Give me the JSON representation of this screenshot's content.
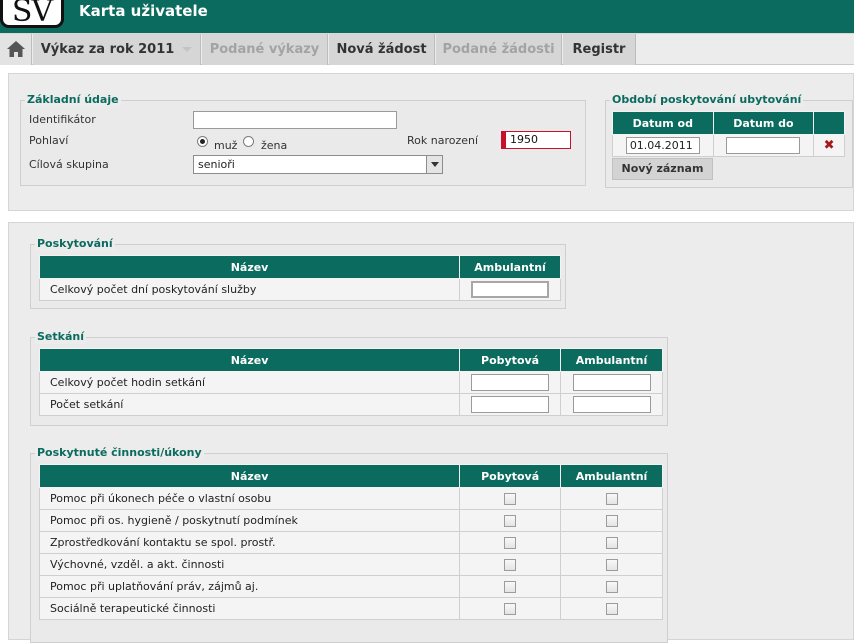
{
  "app": {
    "logo_text": "SV",
    "title": "Karta uživatele"
  },
  "menu": {
    "items": [
      {
        "label": "Výkaz za rok 2011",
        "disabled": false
      },
      {
        "label": "Podané výkazy",
        "disabled": true
      },
      {
        "label": "Nová žádost",
        "disabled": false
      },
      {
        "label": "Podané žádosti",
        "disabled": true
      },
      {
        "label": "Registr",
        "disabled": false
      }
    ]
  },
  "basic": {
    "legend": "Základní údaje",
    "identifier_label": "Identifikátor",
    "identifier_value": "",
    "gender_label": "Pohlaví",
    "gender_male": "muž",
    "gender_female": "žena",
    "gender_selected": "muž",
    "birth_year_label": "Rok narození",
    "birth_year_value": "1950",
    "target_group_label": "Cílová skupina",
    "target_group_value": "senioři"
  },
  "period": {
    "legend": "Období poskytování ubytování",
    "col_from": "Datum od",
    "col_to": "Datum do",
    "from_value": "01.04.2011",
    "to_value": "",
    "new_record_button": "Nový záznam"
  },
  "provision": {
    "legend": "Poskytování",
    "col_name": "Název",
    "col_ambulant": "Ambulantní",
    "rows": [
      "Celkový počet dní poskytování služby"
    ]
  },
  "meetings": {
    "legend": "Setkání",
    "col_name": "Název",
    "col_residential": "Pobytová",
    "col_ambulant": "Ambulantní",
    "rows": [
      "Celkový počet hodin setkání",
      "Počet setkání"
    ]
  },
  "activities": {
    "legend": "Poskytnuté činnosti/úkony",
    "col_name": "Název",
    "col_residential": "Pobytová",
    "col_ambulant": "Ambulantní",
    "rows": [
      "Pomoc při úkonech péče o vlastní osobu",
      "Pomoc při os. hygieně / poskytnutí podmínek",
      "Zprostředkování kontaktu se spol. prostř.",
      "Výchovné, vzděl. a akt. činnosti",
      "Pomoc při uplatňování práv, zájmů aj.",
      "Sociálně terapeutické činnosti"
    ]
  }
}
